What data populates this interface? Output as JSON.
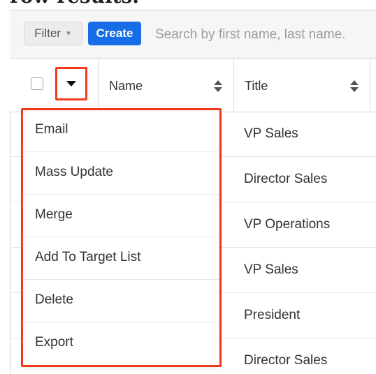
{
  "heading": {
    "text": "row results."
  },
  "filterbar": {
    "filter_label": "Filter",
    "create_label": "Create",
    "search_placeholder": "Search by first name, last name."
  },
  "table": {
    "columns": [
      {
        "label": "Name"
      },
      {
        "label": "Title"
      }
    ],
    "rows": [
      {
        "title": "VP Sales"
      },
      {
        "title": "Director Sales"
      },
      {
        "title": "VP Operations"
      },
      {
        "title": "VP Sales"
      },
      {
        "title": "President"
      },
      {
        "title": "Director Sales"
      }
    ]
  },
  "mass_actions_menu": {
    "items": [
      {
        "label": "Email"
      },
      {
        "label": "Mass Update"
      },
      {
        "label": "Merge"
      },
      {
        "label": "Add To Target List"
      },
      {
        "label": "Delete"
      },
      {
        "label": "Export"
      }
    ]
  },
  "colors": {
    "highlight": "#f23b1b",
    "create_button": "#176de5"
  },
  "icons": {
    "filter_caret": "chevron-down-icon",
    "actions_toggle": "caret-down-icon",
    "sort": "sort-icon"
  }
}
